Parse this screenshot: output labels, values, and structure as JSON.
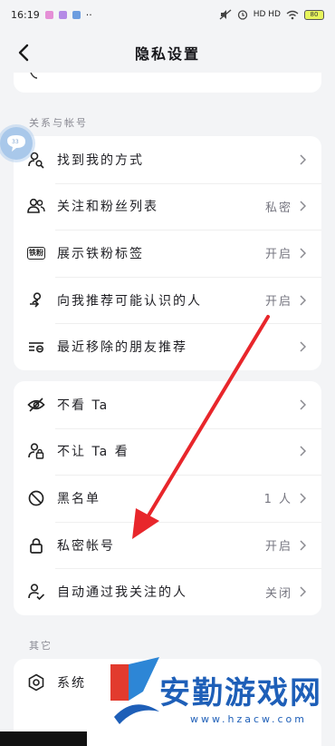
{
  "status_bar": {
    "time": "16:19",
    "more": "··",
    "indicators": "HD HD",
    "battery": "80"
  },
  "nav": {
    "title": "隐私设置",
    "back_icon": "chevron-left-icon"
  },
  "float_bubble": {
    "label": "33"
  },
  "sections": [
    {
      "header": "关系与帐号",
      "rows": [
        {
          "icon": "person-search-icon",
          "label": "找到我的方式",
          "value": ""
        },
        {
          "icon": "people-icon",
          "label": "关注和粉丝列表",
          "value": "私密"
        },
        {
          "icon": "fan-badge-icon",
          "label": "展示铁粉标签",
          "value": "开启",
          "badge_text": "铁粉"
        },
        {
          "icon": "recommend-person-icon",
          "label": "向我推荐可能认识的人",
          "value": "开启"
        },
        {
          "icon": "removed-list-icon",
          "label": "最近移除的朋友推荐",
          "value": ""
        }
      ]
    },
    {
      "header": "",
      "rows": [
        {
          "icon": "eye-off-icon",
          "label": "不看 Ta",
          "value": ""
        },
        {
          "icon": "person-lock-icon",
          "label": "不让 Ta 看",
          "value": ""
        },
        {
          "icon": "block-icon",
          "label": "黑名单",
          "value": "1 人"
        },
        {
          "icon": "lock-icon",
          "label": "私密帐号",
          "value": "开启"
        },
        {
          "icon": "person-check-icon",
          "label": "自动通过我关注的人",
          "value": "关闭"
        }
      ]
    },
    {
      "header": "其它",
      "rows": [
        {
          "icon": "system-hexagon-icon",
          "label": "系统",
          "value": ""
        }
      ]
    }
  ],
  "watermark": {
    "line1": "安勤游戏网",
    "line2": "www.hzacw.com"
  },
  "colors": {
    "background": "#f3f4f6",
    "card": "#ffffff",
    "arrow": "#e8262b",
    "watermark_blue": "#1e5fb8"
  }
}
